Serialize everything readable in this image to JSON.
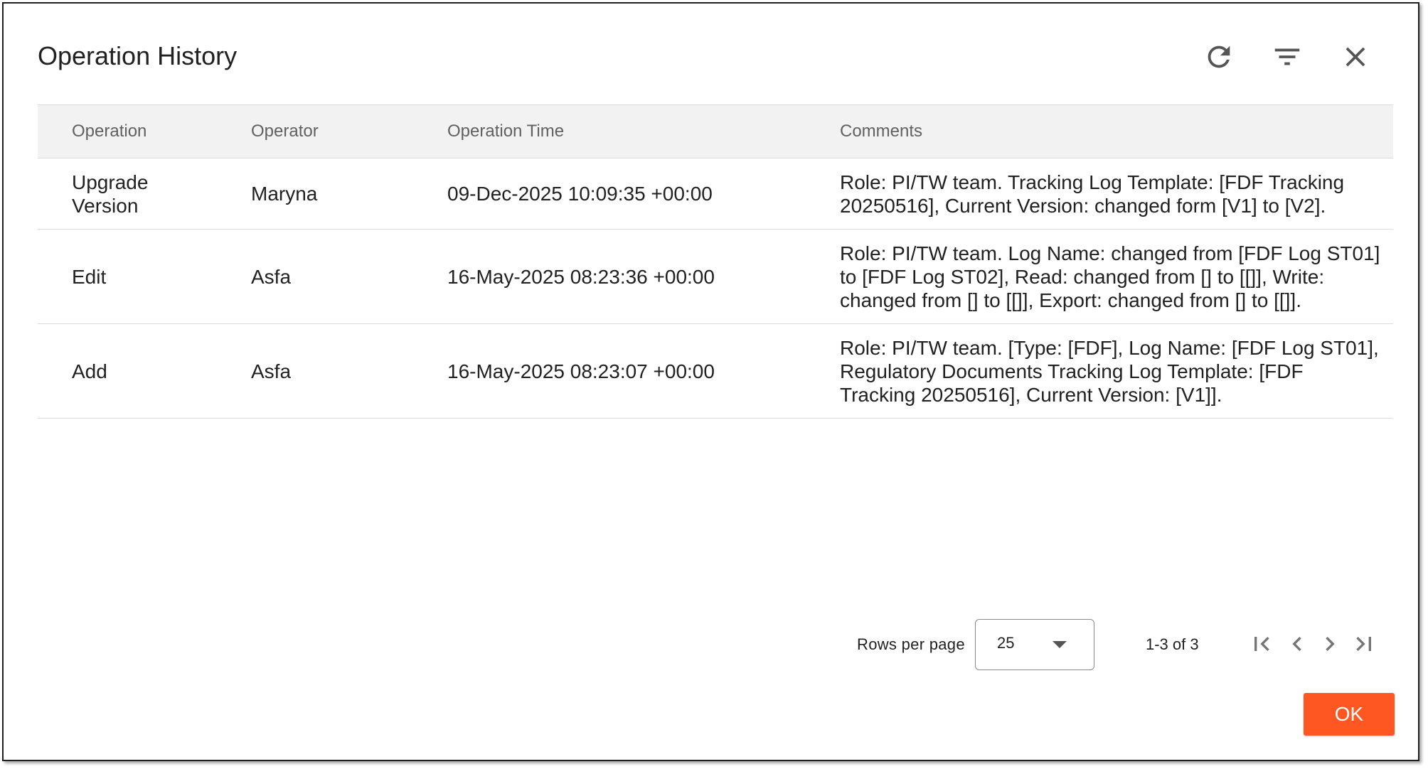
{
  "dialog": {
    "title": "Operation History",
    "icons": {
      "refresh": "refresh-icon",
      "filter": "filter-icon",
      "close": "close-icon"
    }
  },
  "table": {
    "columns": [
      "Operation",
      "Operator",
      "Operation Time",
      "Comments"
    ],
    "rows": [
      {
        "operation": "Upgrade Version",
        "operator": "Maryna",
        "time": "09-Dec-2025 10:09:35 +00:00",
        "comments": "Role: PI/TW team. Tracking Log Template: [FDF Tracking 20250516], Current Version: changed form [V1] to [V2]."
      },
      {
        "operation": "Edit",
        "operator": "Asfa",
        "time": "16-May-2025 08:23:36 +00:00",
        "comments": "Role: PI/TW team. Log Name: changed from [FDF Log ST01] to [FDF Log ST02], Read: changed from [] to [[]], Write: changed from [] to [[]], Export: changed from [] to [[]]."
      },
      {
        "operation": "Add",
        "operator": "Asfa",
        "time": "16-May-2025 08:23:07 +00:00",
        "comments": "Role: PI/TW team. [Type: [FDF], Log Name: [FDF Log ST01], Regulatory Documents Tracking Log Template: [FDF Tracking 20250516], Current Version: [V1]]."
      }
    ]
  },
  "pagination": {
    "rows_per_page_label": "Rows per page",
    "rows_per_page_value": "25",
    "range": "1-3 of 3"
  },
  "footer": {
    "ok_label": "OK"
  },
  "colors": {
    "accent": "#ff5722",
    "header_bg": "#f2f2f2",
    "divider": "#dadada"
  }
}
